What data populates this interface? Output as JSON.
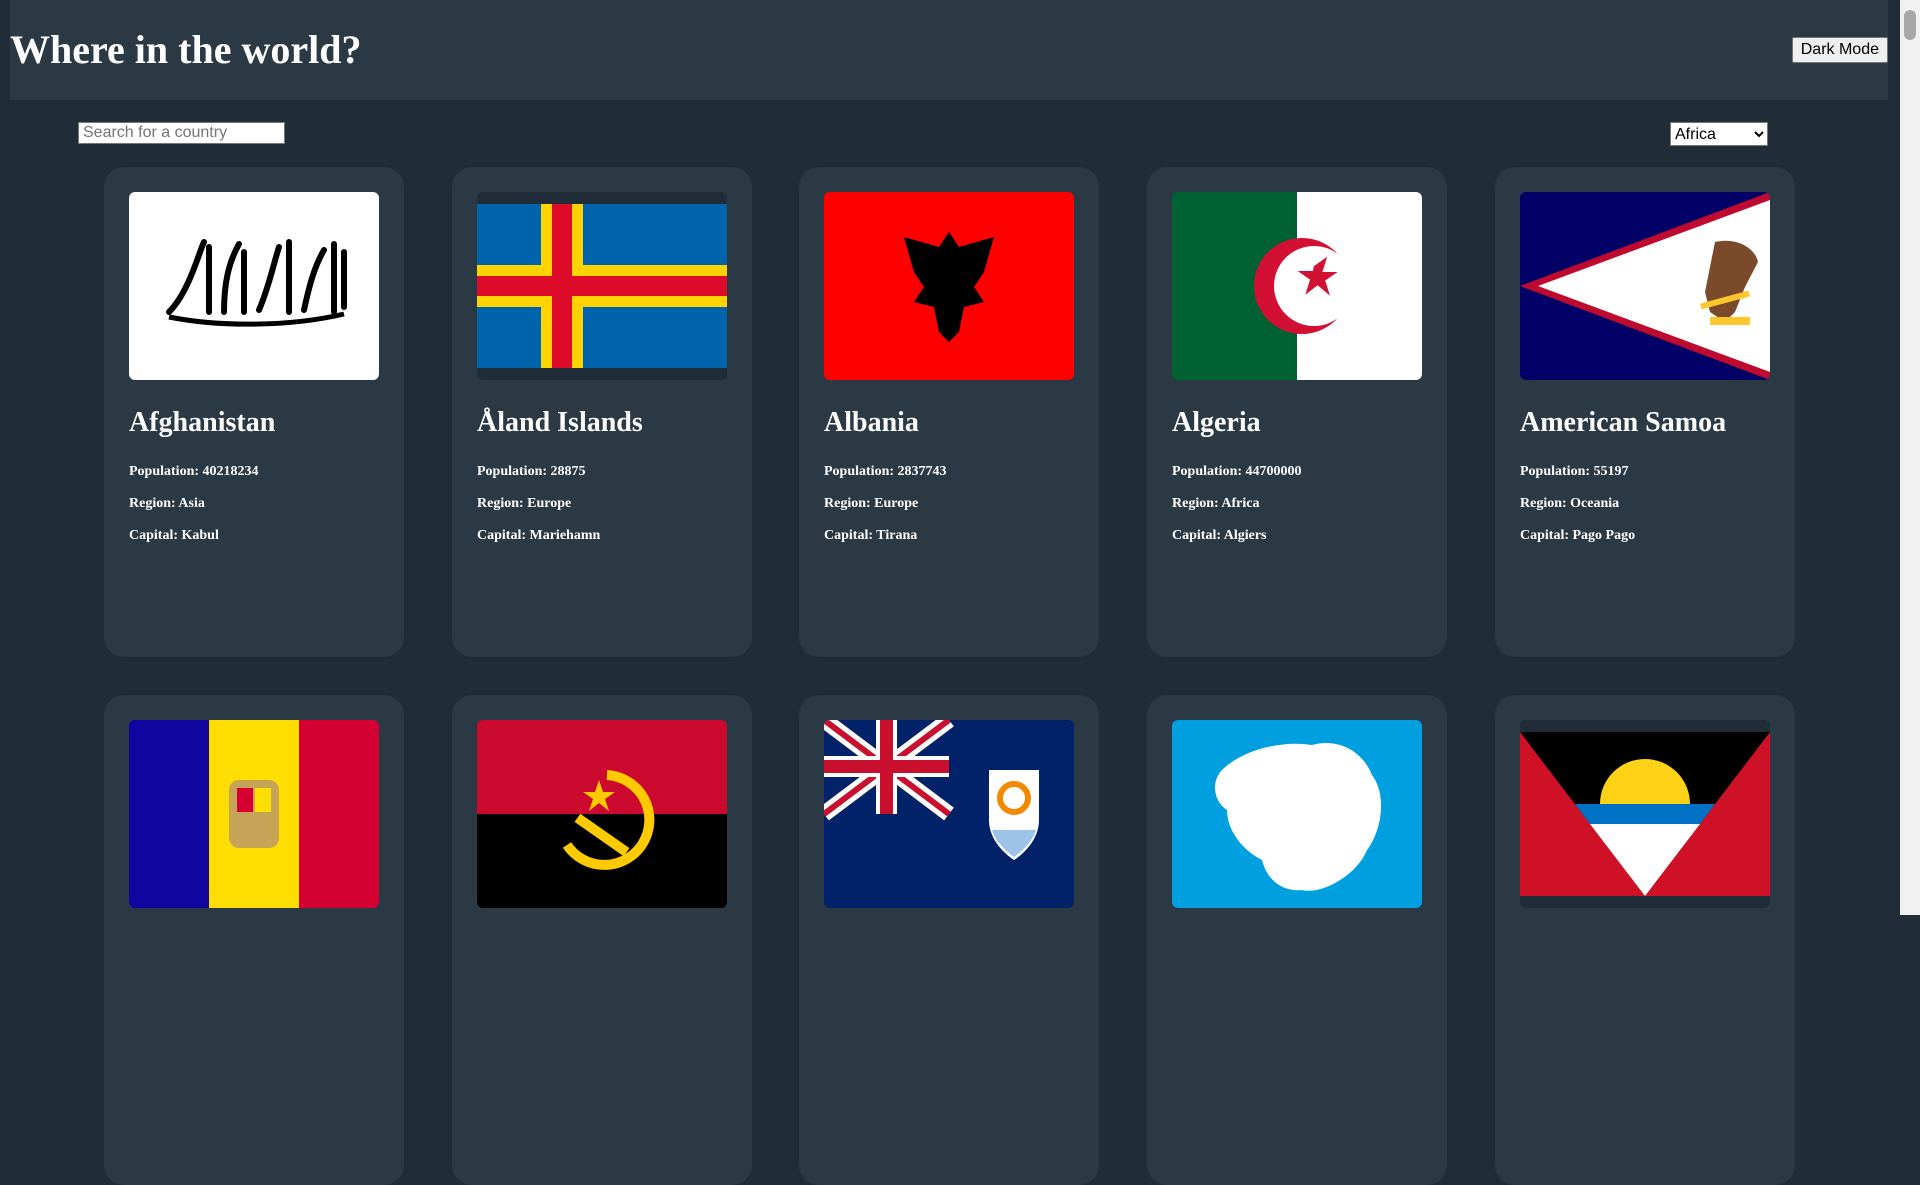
{
  "header": {
    "title": "Where in the world?",
    "dark_mode_label": "Dark Mode"
  },
  "controls": {
    "search_placeholder": "Search for a country",
    "search_value": "",
    "region_selected": "Africa"
  },
  "labels": {
    "population": "Population:",
    "region": "Region:",
    "capital": "Capital:"
  },
  "countries": [
    {
      "name": "Afghanistan",
      "population": "40218234",
      "region": "Asia",
      "capital": "Kabul"
    },
    {
      "name": "Åland Islands",
      "population": "28875",
      "region": "Europe",
      "capital": "Mariehamn"
    },
    {
      "name": "Albania",
      "population": "2837743",
      "region": "Europe",
      "capital": "Tirana"
    },
    {
      "name": "Algeria",
      "population": "44700000",
      "region": "Africa",
      "capital": "Algiers"
    },
    {
      "name": "American Samoa",
      "population": "55197",
      "region": "Oceania",
      "capital": "Pago Pago"
    },
    {
      "name": "",
      "population": "",
      "region": "",
      "capital": ""
    },
    {
      "name": "",
      "population": "",
      "region": "",
      "capital": ""
    },
    {
      "name": "",
      "population": "",
      "region": "",
      "capital": ""
    },
    {
      "name": "",
      "population": "",
      "region": "",
      "capital": ""
    },
    {
      "name": "",
      "population": "",
      "region": "",
      "capital": ""
    }
  ],
  "flag_icons": [
    "afghanistan-flag-icon",
    "aland-islands-flag-icon",
    "albania-flag-icon",
    "algeria-flag-icon",
    "american-samoa-flag-icon",
    "andorra-flag-icon",
    "angola-flag-icon",
    "anguilla-flag-icon",
    "antarctica-flag-icon",
    "antigua-and-barbuda-flag-icon"
  ],
  "colors": {
    "background": "#202c37",
    "element": "#2b3945",
    "text": "#ffffff"
  }
}
